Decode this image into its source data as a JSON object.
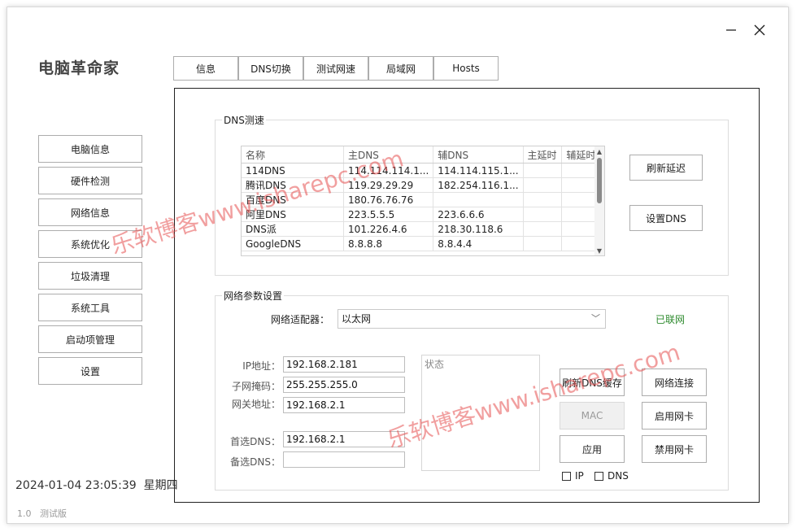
{
  "app": {
    "title": "电脑革命家",
    "datetime": "2024-01-04 23:05:39",
    "weekday": "星期四",
    "version_number": "1.0",
    "version_label": "测试版",
    "minimize_icon": "minimize-icon",
    "close_icon": "close-icon"
  },
  "tabs": [
    {
      "label": "信息"
    },
    {
      "label": "DNS切换"
    },
    {
      "label": "测试网速"
    },
    {
      "label": "局域网"
    },
    {
      "label": "Hosts"
    }
  ],
  "nav": [
    {
      "label": "电脑信息"
    },
    {
      "label": "硬件检测"
    },
    {
      "label": "网络信息"
    },
    {
      "label": "系统优化"
    },
    {
      "label": "垃圾清理"
    },
    {
      "label": "系统工具"
    },
    {
      "label": "启动项管理"
    },
    {
      "label": "设置"
    }
  ],
  "dns_test": {
    "title": "DNS测速",
    "columns": [
      "名称",
      "主DNS",
      "辅DNS",
      "主延时",
      "辅延时"
    ],
    "rows": [
      {
        "name": "114DNS",
        "primary": "114.114.114.1...",
        "secondary": "114.114.115.1...",
        "primary_delay": "",
        "secondary_delay": ""
      },
      {
        "name": "腾讯DNS",
        "primary": "119.29.29.29",
        "secondary": "182.254.116.1...",
        "primary_delay": "",
        "secondary_delay": ""
      },
      {
        "name": "百度DNS",
        "primary": "180.76.76.76",
        "secondary": "",
        "primary_delay": "",
        "secondary_delay": ""
      },
      {
        "name": "阿里DNS",
        "primary": "223.5.5.5",
        "secondary": "223.6.6.6",
        "primary_delay": "",
        "secondary_delay": ""
      },
      {
        "name": "DNS派",
        "primary": "101.226.4.6",
        "secondary": "218.30.118.6",
        "primary_delay": "",
        "secondary_delay": ""
      },
      {
        "name": "GoogleDNS",
        "primary": "8.8.8.8",
        "secondary": "8.8.4.4",
        "primary_delay": "",
        "secondary_delay": ""
      }
    ],
    "refresh_delay_label": "刷新延迟",
    "set_dns_label": "设置DNS"
  },
  "net_settings": {
    "title": "网络参数设置",
    "adapter_label": "网络适配器：",
    "adapter_value": "以太网",
    "connected_status": "已联网",
    "connected_color": "#2e8b2e",
    "ip_label": "IP地址：",
    "ip_value": "192.168.2.181",
    "mask_label": "子网掩码：",
    "mask_value": "255.255.255.0",
    "gateway_label": "网关地址：",
    "gateway_value": "192.168.2.1",
    "dns1_label": "首选DNS：",
    "dns1_value": "192.168.2.1",
    "dns2_label": "备选DNS：",
    "dns2_value": "",
    "status_title": "状态",
    "flush_dns_label": "刷新DNS缓存",
    "mac_label": "MAC",
    "apply_label": "应用",
    "net_connect_label": "网络连接",
    "enable_nic_label": "启用网卡",
    "disable_nic_label": "禁用网卡",
    "check_ip_label": "IP",
    "check_dns_label": "DNS"
  },
  "watermark": {
    "text": "乐软博客www.isharepc.com"
  }
}
